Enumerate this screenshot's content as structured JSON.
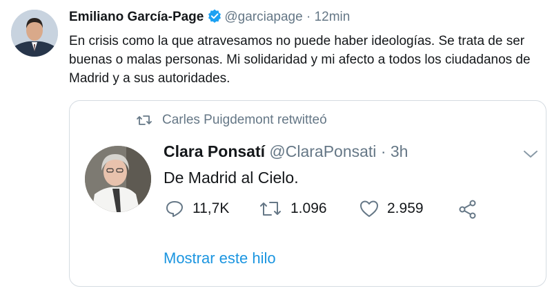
{
  "tweet": {
    "author_name": "Emiliano García-Page",
    "verified_icon": "verified-badge-icon",
    "handle": "@garciapage",
    "separator": "·",
    "time": "12min",
    "text": "En crisis como la que atravesamos no puede haber ideologías. Se trata de ser buenas o malas personas. Mi solidaridad y mi afecto a todos los ciudadanos de Madrid y a sus autoridades."
  },
  "quoted": {
    "retweet_label": "Carles Puigdemont retwitteó",
    "author_name": "Clara Ponsatí",
    "handle": "@ClaraPonsati",
    "separator": "·",
    "time": "3h",
    "text": "De Madrid al Cielo.",
    "replies": "11,7K",
    "retweets": "1.096",
    "likes": "2.959",
    "show_thread": "Mostrar este hilo"
  },
  "colors": {
    "accent": "#1b95e0",
    "muted": "#657786",
    "border": "#d4dbe1"
  }
}
